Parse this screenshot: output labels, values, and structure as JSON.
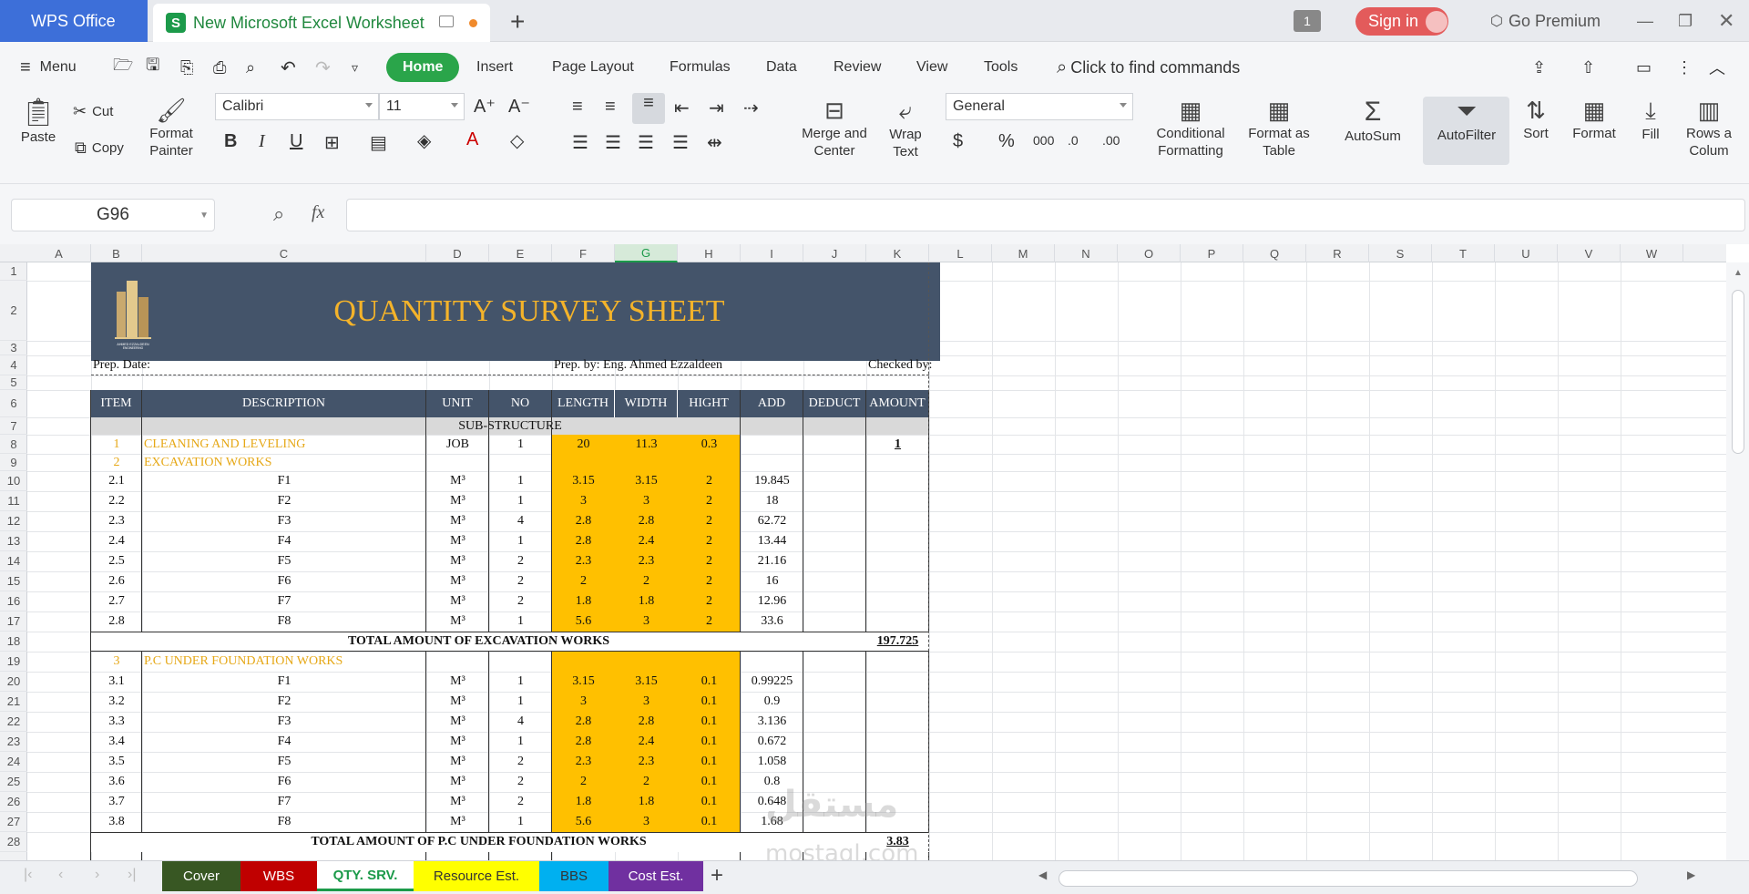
{
  "app": {
    "brand": "WPS Office",
    "file_tab": "New Microsoft Excel Worksheet",
    "sheet_count_badge": "1",
    "signin": "Sign in",
    "premium": "Go Premium"
  },
  "menu": {
    "menu_label": "Menu",
    "tabs": [
      "Home",
      "Insert",
      "Page Layout",
      "Formulas",
      "Data",
      "Review",
      "View",
      "Tools"
    ],
    "search": "Click to find commands"
  },
  "ribbon": {
    "paste": "Paste",
    "cut": "Cut",
    "copy": "Copy",
    "format_painter_1": "Format",
    "format_painter_2": "Painter",
    "font": "Calibri",
    "size": "11",
    "merge_1": "Merge and",
    "merge_2": "Center",
    "wrap_1": "Wrap",
    "wrap_2": "Text",
    "number_format": "General",
    "cond_1": "Conditional",
    "cond_2": "Formatting",
    "fat_1": "Format as",
    "fat_2": "Table",
    "autosum": "AutoSum",
    "autofilter": "AutoFilter",
    "sort": "Sort",
    "format": "Format",
    "fill": "Fill",
    "rows_1": "Rows a",
    "rows_2": "Colum"
  },
  "formula_bar": {
    "name_box": "G96",
    "fx": "fx",
    "value": ""
  },
  "columns": [
    "A",
    "B",
    "C",
    "D",
    "E",
    "F",
    "G",
    "H",
    "I",
    "J",
    "K",
    "L",
    "M",
    "N",
    "O",
    "P",
    "Q",
    "R",
    "S",
    "T",
    "U",
    "V",
    "W"
  ],
  "rows": [
    "1",
    "2",
    "3",
    "4",
    "5",
    "6",
    "7",
    "8",
    "9",
    "10",
    "11",
    "12",
    "13",
    "14",
    "15",
    "16",
    "17",
    "18",
    "19",
    "20",
    "21",
    "22",
    "23",
    "24",
    "25",
    "26",
    "27",
    "28"
  ],
  "sheet": {
    "title": "QUANTITY SURVEY SHEET",
    "logo_text": "AHMED EZZALDEEN ENGINEERING",
    "prep_date": "Prep. Date:",
    "prep_by": "Prep. by: Eng. Ahmed Ezzaldeen",
    "checked_by": "Checked by:",
    "headers": [
      "ITEM",
      "DESCRIPTION",
      "UNIT",
      "NO",
      "LENGTH",
      "WIDTH",
      "HIGHT",
      "ADD",
      "DEDUCT",
      "AMOUNT"
    ],
    "section": "SUB-STRUCTURE",
    "row8": {
      "item": "1",
      "desc": "CLEANING AND LEVELING",
      "unit": "JOB",
      "no": "1",
      "len": "20",
      "wid": "11.3",
      "hgt": "0.3",
      "amount": "1"
    },
    "row9": {
      "item": "2",
      "desc": "EXCAVATION WORKS"
    },
    "exc": [
      {
        "item": "2.1",
        "desc": "F1",
        "unit": "M³",
        "no": "1",
        "len": "3.15",
        "wid": "3.15",
        "hgt": "2",
        "add": "19.845"
      },
      {
        "item": "2.2",
        "desc": "F2",
        "unit": "M³",
        "no": "1",
        "len": "3",
        "wid": "3",
        "hgt": "2",
        "add": "18"
      },
      {
        "item": "2.3",
        "desc": "F3",
        "unit": "M³",
        "no": "4",
        "len": "2.8",
        "wid": "2.8",
        "hgt": "2",
        "add": "62.72"
      },
      {
        "item": "2.4",
        "desc": "F4",
        "unit": "M³",
        "no": "1",
        "len": "2.8",
        "wid": "2.4",
        "hgt": "2",
        "add": "13.44"
      },
      {
        "item": "2.5",
        "desc": "F5",
        "unit": "M³",
        "no": "2",
        "len": "2.3",
        "wid": "2.3",
        "hgt": "2",
        "add": "21.16"
      },
      {
        "item": "2.6",
        "desc": "F6",
        "unit": "M³",
        "no": "2",
        "len": "2",
        "wid": "2",
        "hgt": "2",
        "add": "16"
      },
      {
        "item": "2.7",
        "desc": "F7",
        "unit": "M³",
        "no": "2",
        "len": "1.8",
        "wid": "1.8",
        "hgt": "2",
        "add": "12.96"
      },
      {
        "item": "2.8",
        "desc": "F8",
        "unit": "M³",
        "no": "1",
        "len": "5.6",
        "wid": "3",
        "hgt": "2",
        "add": "33.6"
      }
    ],
    "total_exc": {
      "label": "TOTAL AMOUNT OF EXCAVATION WORKS",
      "amount": "197.725"
    },
    "row19": {
      "item": "3",
      "desc": "P.C UNDER FOUNDATION WORKS"
    },
    "pc": [
      {
        "item": "3.1",
        "desc": "F1",
        "unit": "M³",
        "no": "1",
        "len": "3.15",
        "wid": "3.15",
        "hgt": "0.1",
        "add": "0.99225"
      },
      {
        "item": "3.2",
        "desc": "F2",
        "unit": "M³",
        "no": "1",
        "len": "3",
        "wid": "3",
        "hgt": "0.1",
        "add": "0.9"
      },
      {
        "item": "3.3",
        "desc": "F3",
        "unit": "M³",
        "no": "4",
        "len": "2.8",
        "wid": "2.8",
        "hgt": "0.1",
        "add": "3.136"
      },
      {
        "item": "3.4",
        "desc": "F4",
        "unit": "M³",
        "no": "1",
        "len": "2.8",
        "wid": "2.4",
        "hgt": "0.1",
        "add": "0.672"
      },
      {
        "item": "3.5",
        "desc": "F5",
        "unit": "M³",
        "no": "2",
        "len": "2.3",
        "wid": "2.3",
        "hgt": "0.1",
        "add": "1.058"
      },
      {
        "item": "3.6",
        "desc": "F6",
        "unit": "M³",
        "no": "2",
        "len": "2",
        "wid": "2",
        "hgt": "0.1",
        "add": "0.8"
      },
      {
        "item": "3.7",
        "desc": "F7",
        "unit": "M³",
        "no": "2",
        "len": "1.8",
        "wid": "1.8",
        "hgt": "0.1",
        "add": "0.648"
      },
      {
        "item": "3.8",
        "desc": "F8",
        "unit": "M³",
        "no": "1",
        "len": "5.6",
        "wid": "3",
        "hgt": "0.1",
        "add": "1.68"
      }
    ],
    "total_pc": {
      "label": "TOTAL AMOUNT OF P.C UNDER FOUNDATION WORKS",
      "amount": "3.83"
    }
  },
  "sheet_tabs": [
    {
      "label": "Cover",
      "bg": "#385723",
      "fg": "#ffffff"
    },
    {
      "label": "WBS",
      "bg": "#c00000",
      "fg": "#ffffff"
    },
    {
      "label": "QTY. SRV.",
      "bg": "#ffffff",
      "fg": "#1c9a4a"
    },
    {
      "label": "Resource Est.",
      "bg": "#ffff00",
      "fg": "#333333"
    },
    {
      "label": "BBS",
      "bg": "#00b0f0",
      "fg": "#333333"
    },
    {
      "label": "Cost Est.",
      "bg": "#7030a0",
      "fg": "#ffffff"
    }
  ],
  "watermark": {
    "arabic": "مستقل",
    "latin": "mostaql.com"
  },
  "colors": {
    "accent": "#2aa54a",
    "header": "#44546a",
    "highlight": "#ffc000",
    "brand": "#3d6fd9"
  }
}
